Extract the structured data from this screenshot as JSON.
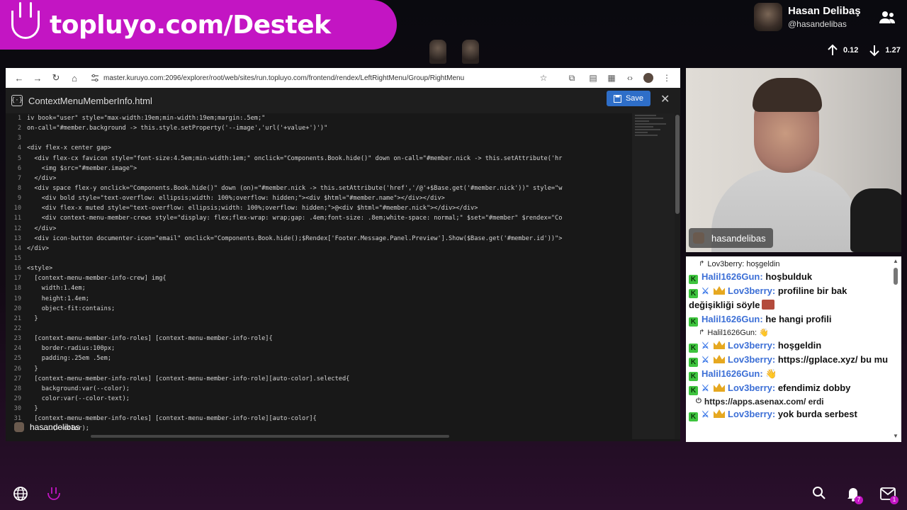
{
  "banner": {
    "text": "topluyo.com/Destek"
  },
  "profile": {
    "name": "Hasan Delibaş",
    "handle": "@hasandelibas"
  },
  "stats": {
    "up": "0.12",
    "down": "1.27"
  },
  "browser": {
    "url": "master.kuruyo.com:2096/explorer/root/web/sites/run.topluyo.com/frontend/rendex/LeftRightMenu/Group/RightMenu"
  },
  "editor": {
    "file_name": "ContextMenuMemberInfo.html",
    "save_label": "Save",
    "close_label": "✕",
    "file_icon": "{·}",
    "lines": [
      {
        "n": "1",
        "t": "iv book=\"user\" style=\"max-width:19em;min-width:19em;margin:.5em;\""
      },
      {
        "n": "2",
        "t": "on-call=\"#member.background -> this.style.setProperty('--image','url('+value+')')\""
      },
      {
        "n": "3",
        "t": ""
      },
      {
        "n": "4",
        "t": "<div flex-x center gap>"
      },
      {
        "n": "5",
        "t": "  <div flex-cx favicon style=\"font-size:4.5em;min-width:1em;\" onclick=\"Components.Book.hide()\" down on-call=\"#member.nick -> this.setAttribute('hr"
      },
      {
        "n": "6",
        "t": "    <img $src=\"#member.image\">"
      },
      {
        "n": "7",
        "t": "  </div>"
      },
      {
        "n": "8",
        "t": "  <div space flex-y onclick=\"Components.Book.hide()\" down (on)=\"#member.nick -> this.setAttribute('href','/@'+$Base.get('#member.nick'))\" style=\"w"
      },
      {
        "n": "9",
        "t": "    <div bold style=\"text-overflow: ellipsis;width: 100%;overflow: hidden;\"><div $html=\"#member.name\"></div></div>"
      },
      {
        "n": "10",
        "t": "    <div flex-x muted style=\"text-overflow: ellipsis;width: 100%;overflow: hidden;\">@<div $html=\"#member.nick\"></div></div>"
      },
      {
        "n": "11",
        "t": "    <div context-menu-member-crews style=\"display: flex;flex-wrap: wrap;gap: .4em;font-size: .8em;white-space: normal;\" $set=\"#member\" $rendex=\"Co"
      },
      {
        "n": "12",
        "t": "  </div>"
      },
      {
        "n": "13",
        "t": "  <div icon-button documenter-icon=\"email\" onclick=\"Components.Book.hide();$Rendex['Footer.Message.Panel.Preview'].Show($Base.get('#member.id'))\">"
      },
      {
        "n": "14",
        "t": "</div>"
      },
      {
        "n": "15",
        "t": ""
      },
      {
        "n": "16",
        "t": "<style>"
      },
      {
        "n": "17",
        "t": "  [context-menu-member-info-crew] img{"
      },
      {
        "n": "18",
        "t": "    width:1.4em;"
      },
      {
        "n": "19",
        "t": "    height:1.4em;"
      },
      {
        "n": "20",
        "t": "    object-fit:contains;"
      },
      {
        "n": "21",
        "t": "  }"
      },
      {
        "n": "22",
        "t": ""
      },
      {
        "n": "23",
        "t": "  [context-menu-member-info-roles] [context-menu-member-info-role]{"
      },
      {
        "n": "24",
        "t": "    border-radius:100px;"
      },
      {
        "n": "25",
        "t": "    padding:.25em .5em;"
      },
      {
        "n": "26",
        "t": "  }"
      },
      {
        "n": "27",
        "t": "  [context-menu-member-info-roles] [context-menu-member-info-role][auto-color].selected{"
      },
      {
        "n": "28",
        "t": "    background:var(--color);"
      },
      {
        "n": "29",
        "t": "    color:var(--color-text);"
      },
      {
        "n": "30",
        "t": "  }"
      },
      {
        "n": "31",
        "t": "  [context-menu-member-info-roles] [context-menu-member-info-role][auto-color]{"
      },
      {
        "n": "32",
        "t": "    ...(--color);"
      }
    ]
  },
  "viewer_tag": "hasandelibas",
  "webcam": {
    "name": "hasandelibas"
  },
  "chat": {
    "messages": [
      {
        "type": "reply",
        "text": "Lov3berry: hoşgeldin"
      },
      {
        "type": "msg",
        "badges": [
          "k"
        ],
        "nick": "Halil1626Gun:",
        "text": "hoşbulduk",
        "nick_color": "blue"
      },
      {
        "type": "msg",
        "badges": [
          "k",
          "sword",
          "crown"
        ],
        "nick": "Lov3berry:",
        "text": "profiline bir bak değişikliği söyle",
        "emoji": true
      },
      {
        "type": "msg",
        "badges": [
          "k"
        ],
        "nick": "Halil1626Gun:",
        "text": "he hangi profili",
        "nick_color": "blue"
      },
      {
        "type": "reply",
        "text": "Halil1626Gun: 👋"
      },
      {
        "type": "msg",
        "badges": [
          "k",
          "sword",
          "crown"
        ],
        "nick": "Lov3berry:",
        "text": "hoşgeldin"
      },
      {
        "type": "msg",
        "badges": [
          "k",
          "sword",
          "crown"
        ],
        "nick": "Lov3berry:",
        "text": "https://gplace.xyz/ bu mu"
      },
      {
        "type": "msg",
        "badges": [
          "k"
        ],
        "nick": "Halil1626Gun:",
        "text": "👋",
        "nick_color": "blue"
      },
      {
        "type": "msg",
        "badges": [
          "k",
          "sword",
          "crown"
        ],
        "nick": "Lov3berry:",
        "text": "efendimiz dobby"
      },
      {
        "type": "reply2",
        "text": "https://apps.asenax.com/ erdi"
      },
      {
        "type": "msg",
        "badges": [
          "k",
          "sword",
          "crown"
        ],
        "nick": "Lov3berry:",
        "text": "yok burda serbest"
      }
    ]
  },
  "notifications": {
    "bell_count": "7",
    "mail_count": "1"
  }
}
